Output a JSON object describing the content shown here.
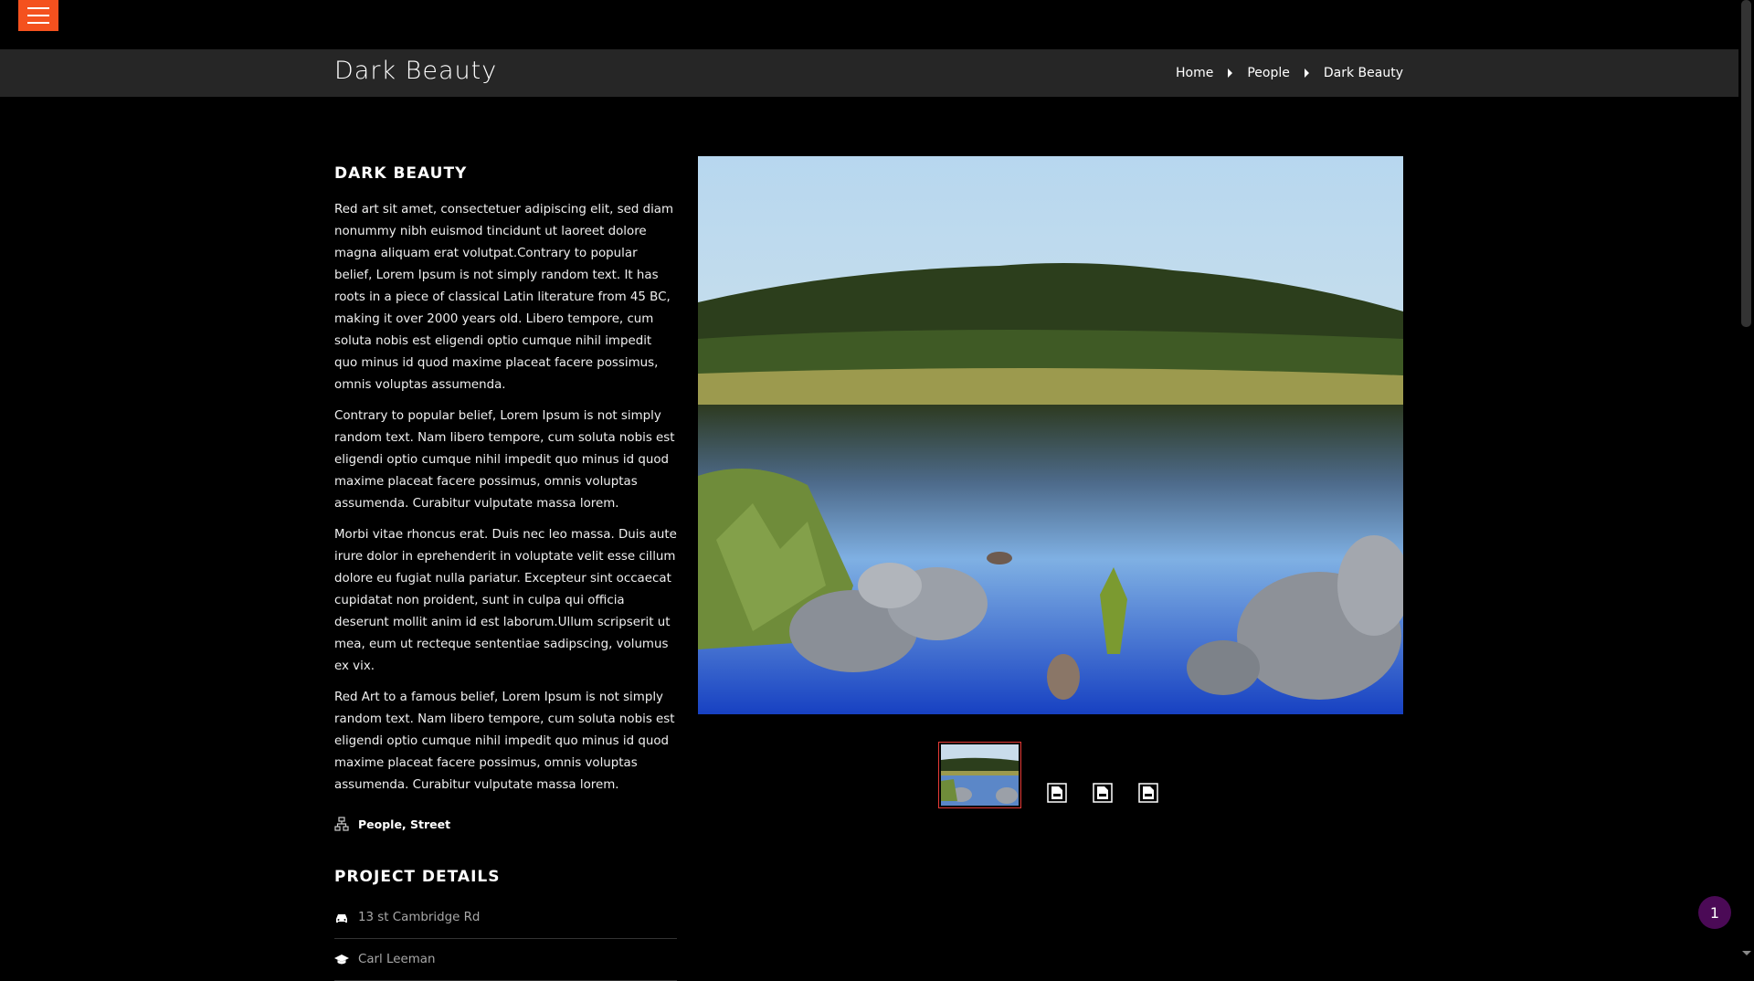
{
  "header": {
    "menu_icon": "hamburger-icon"
  },
  "titlebar": {
    "title": "Dark Beauty",
    "breadcrumb": [
      {
        "label": "Home"
      },
      {
        "label": "People"
      },
      {
        "label": "Dark Beauty"
      }
    ]
  },
  "project": {
    "title": "DARK BEAUTY",
    "paragraphs": [
      "Red art sit amet, consectetuer adipiscing elit, sed diam nonummy nibh euismod tincidunt ut laoreet dolore magna aliquam erat volutpat.Contrary to popular belief, Lorem Ipsum is not simply random text. It has roots in a piece of classical Latin literature from 45 BC, making it over 2000 years old. Libero tempore, cum soluta nobis est eligendi optio cumque nihil impedit quo minus id quod maxime placeat facere possimus, omnis voluptas assumenda.",
      "Contrary to popular belief, Lorem Ipsum is not simply random text. Nam libero tempore, cum soluta nobis est eligendi optio cumque nihil impedit quo minus id quod maxime placeat facere possimus, omnis voluptas assumenda. Curabitur vulputate massa lorem.",
      "Morbi vitae rhoncus erat. Duis nec leo massa. Duis aute irure dolor in eprehenderit in voluptate velit esse cillum dolore eu fugiat nulla pariatur. Excepteur sint occaecat cupidatat non proident, sunt in culpa qui officia deserunt mollit anim id est laborum.Ullum scripserit ut mea, eum ut recteque sententiae sadipscing, volumus ex vix.",
      "Red Art to a famous belief, Lorem Ipsum is not simply random text. Nam libero tempore, cum soluta nobis est eligendi optio cumque nihil impedit quo minus id quod maxime placeat facere possimus, omnis voluptas assumenda. Curabitur vulputate massa lorem."
    ],
    "categories": "People, Street",
    "categories_icon": "sitemap-icon"
  },
  "details": {
    "title": "PROJECT DETAILS",
    "rows": [
      {
        "icon": "car-icon",
        "text": "13 st Cambridge Rd"
      },
      {
        "icon": "graduation-cap-icon",
        "text": "Carl Leeman"
      }
    ]
  },
  "gallery": {
    "main_image": "lake-landscape-painting",
    "thumbnail_count": 4,
    "active_thumbnail": 1
  },
  "notification": {
    "count": "1"
  },
  "colors": {
    "accent": "#f4511e",
    "titlebar_bg": "#262626",
    "badge": "#4b0a56",
    "thumb_border": "#e53935"
  }
}
